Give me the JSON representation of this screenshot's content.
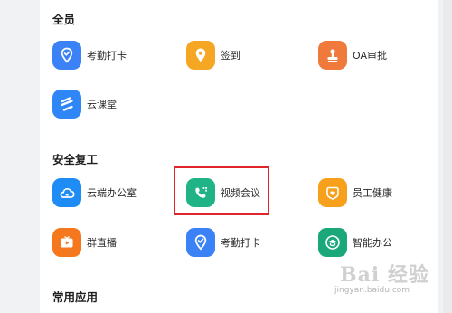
{
  "sections": [
    {
      "title": "全员",
      "apps": [
        {
          "label": "考勤打卡",
          "icon": "location-pin-icon",
          "color": "#3b82f6"
        },
        {
          "label": "签到",
          "icon": "location-pin-icon",
          "color": "#f5a623"
        },
        {
          "label": "OA审批",
          "icon": "stamp-icon",
          "color": "#f07a3c"
        },
        {
          "label": "云课堂",
          "icon": "layers-icon",
          "color": "#2f86f6"
        }
      ]
    },
    {
      "title": "安全复工",
      "apps": [
        {
          "label": "云端办公室",
          "icon": "cloud-icon",
          "color": "#1f8cf5"
        },
        {
          "label": "视频会议",
          "icon": "phone-icon",
          "color": "#1fb386"
        },
        {
          "label": "员工健康",
          "icon": "heart-icon",
          "color": "#f7a01c"
        },
        {
          "label": "群直播",
          "icon": "tv-icon",
          "color": "#f5781e"
        },
        {
          "label": "考勤打卡",
          "icon": "location-pin-icon",
          "color": "#3b82f6"
        },
        {
          "label": "智能办公",
          "icon": "graduation-cap-icon",
          "color": "#1aa77a"
        }
      ]
    },
    {
      "title": "常用应用",
      "apps": []
    }
  ],
  "watermark": {
    "logo": "Bai 经验",
    "url": "jingyan.baidu.com"
  },
  "colors": {
    "highlight_border": "#e0262b",
    "background": "#f1f2f4",
    "panel": "#ffffff"
  }
}
